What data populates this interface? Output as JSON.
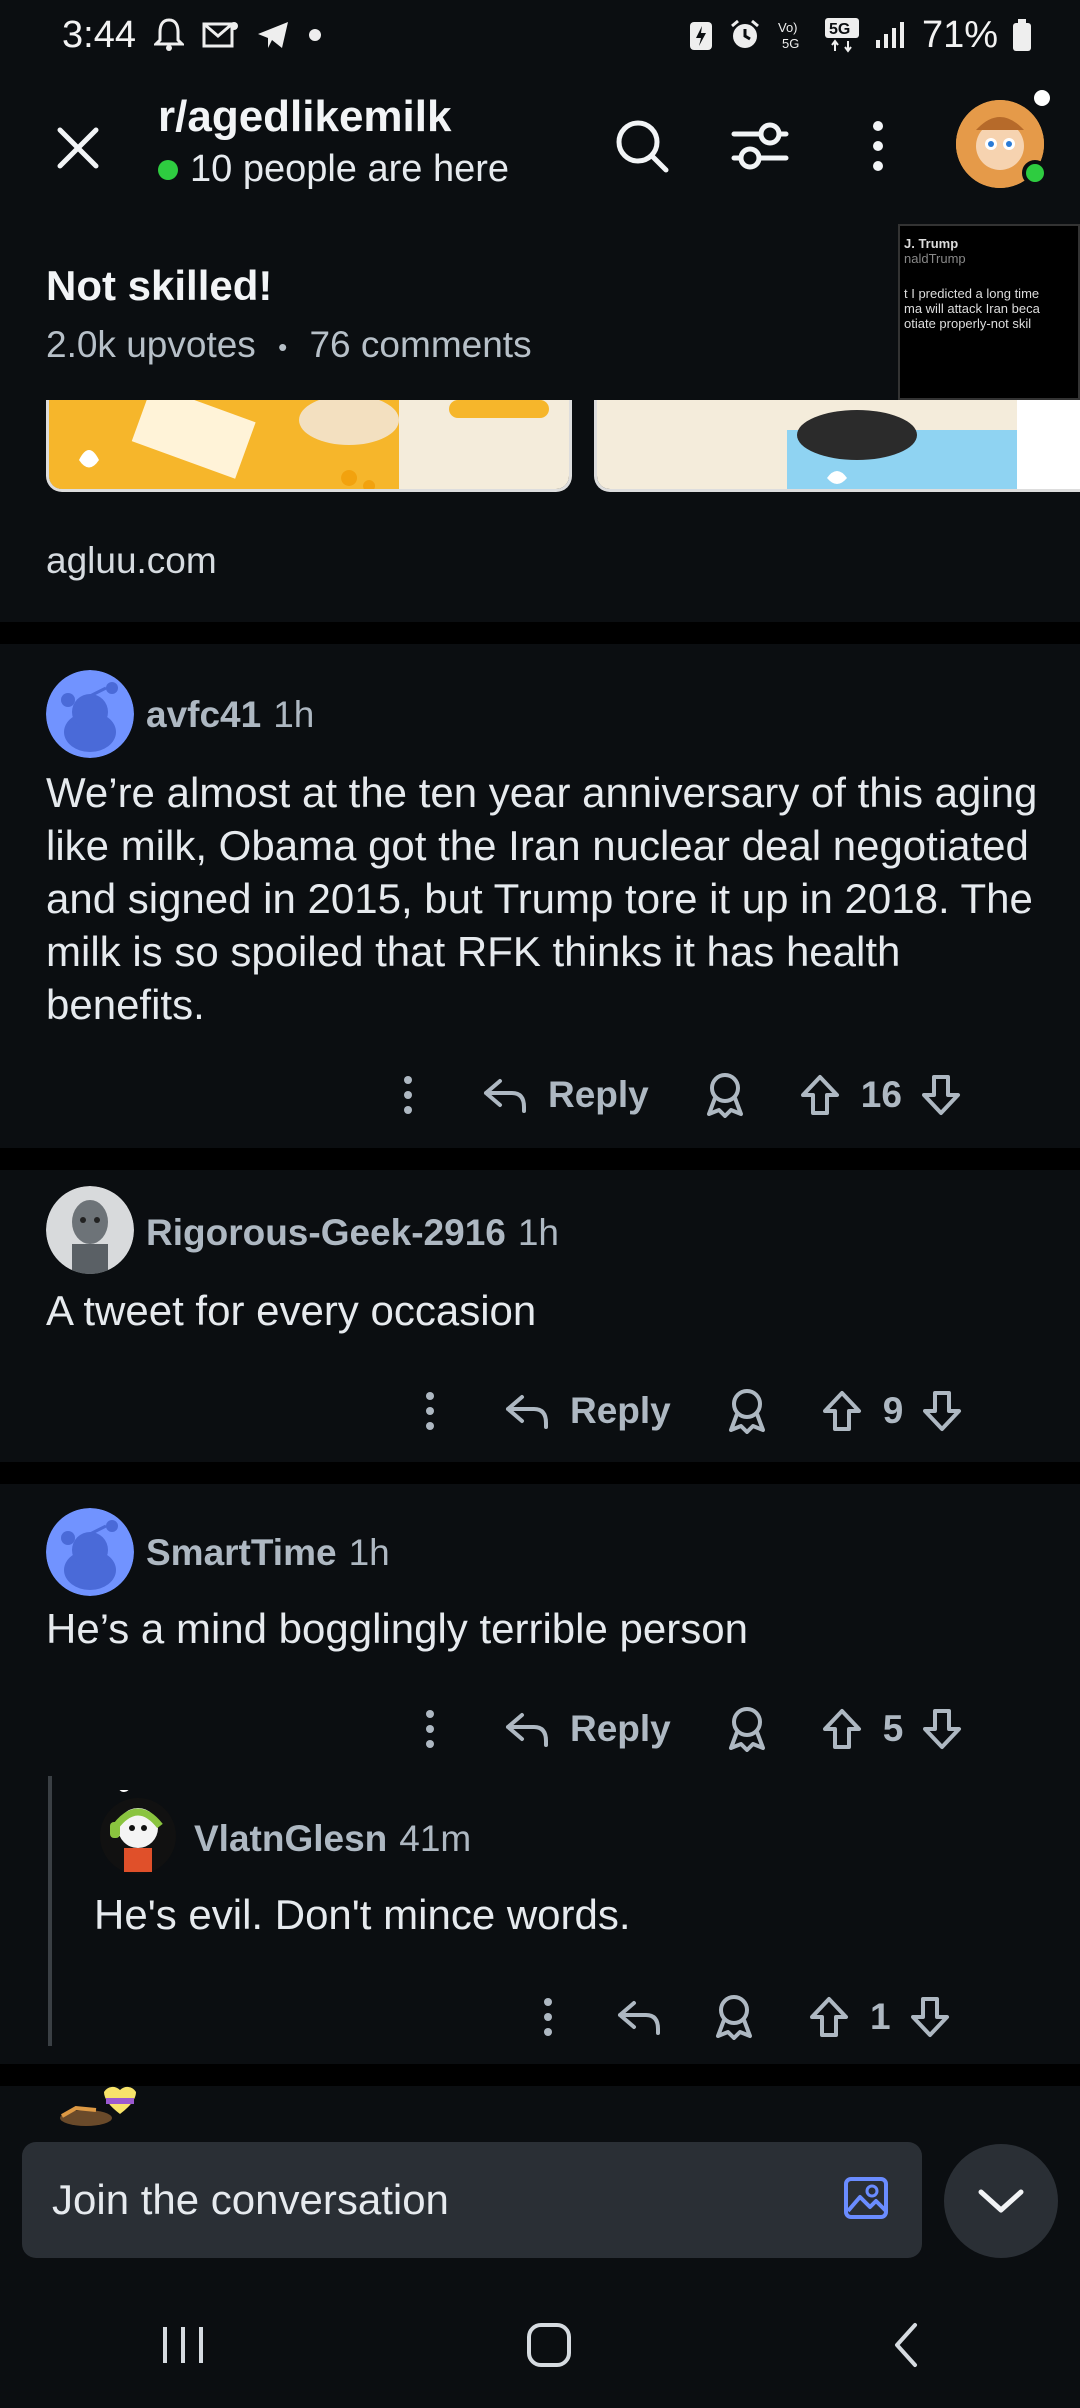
{
  "status_bar": {
    "time": "3:44",
    "battery": "71%",
    "net_label": "5G"
  },
  "header": {
    "subreddit": "r/agedlikemilk",
    "presence": "10 people are here"
  },
  "post": {
    "title": "Not skilled!",
    "upvotes": "2.0k upvotes",
    "separator": "•",
    "comments": "76 comments",
    "thumb_lines": [
      "J. Trump",
      "naldTrump",
      "",
      "t I predicted a long time",
      "ma will attack Iran beca",
      "otiate properly-not skil"
    ],
    "domain": "agluu.com"
  },
  "comments": [
    {
      "author": "avfc41",
      "time": "1h",
      "body": "We’re almost at the ten year anniversary of this aging like milk, Obama got the Iran nuclear deal negotiated and signed in 2015, but Trump tore it up in 2018. The milk is so spoiled that RFK thinks it has health benefits.",
      "reply_label": "Reply",
      "votes": "16"
    },
    {
      "author": "Rigorous-Geek-2916",
      "time": "1h",
      "body": "A tweet for every occasion",
      "reply_label": "Reply",
      "votes": "9"
    },
    {
      "author": "SmartTime",
      "time": "1h",
      "body": "He’s a mind bogglingly terrible person",
      "reply_label": "Reply",
      "votes": "5"
    },
    {
      "author": "VlatnGlesn",
      "time": "41m",
      "body": "He's evil. Don't mince words.",
      "votes": "1"
    }
  ],
  "composer": {
    "placeholder": "Join the conversation"
  },
  "colors": {
    "background": "#0b0e11",
    "online": "#2ecc40",
    "action_gray": "#aeb8c2",
    "image_icon": "#6a8cff"
  }
}
